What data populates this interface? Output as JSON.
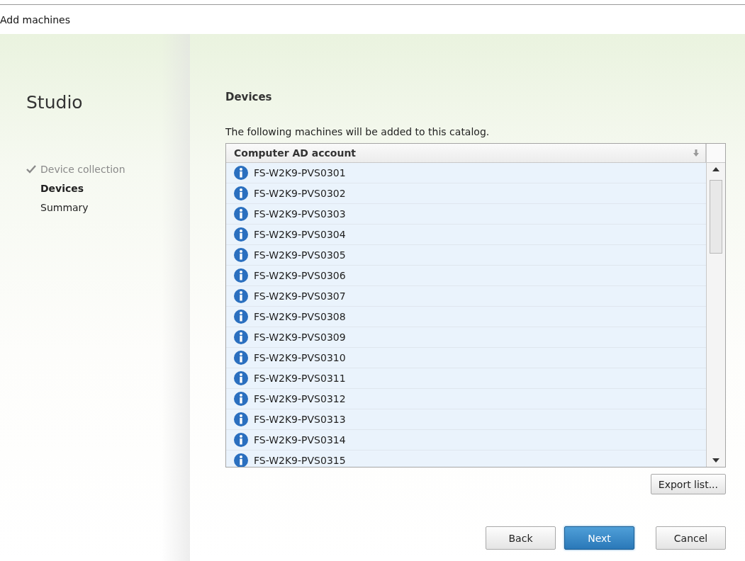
{
  "window": {
    "title": "Add machines"
  },
  "sidebar": {
    "title": "Studio",
    "steps": [
      {
        "label": "Device collection",
        "completed": true,
        "selected": false
      },
      {
        "label": "Devices",
        "completed": false,
        "selected": true
      },
      {
        "label": "Summary",
        "completed": false,
        "selected": false
      }
    ]
  },
  "page": {
    "heading": "Devices",
    "description": "The following machines will be added to this catalog."
  },
  "table": {
    "columns": [
      {
        "label": "Computer AD account",
        "sorted": true
      }
    ],
    "rows": [
      {
        "name": "FS-W2K9-PVS0301"
      },
      {
        "name": "FS-W2K9-PVS0302"
      },
      {
        "name": "FS-W2K9-PVS0303"
      },
      {
        "name": "FS-W2K9-PVS0304"
      },
      {
        "name": "FS-W2K9-PVS0305"
      },
      {
        "name": "FS-W2K9-PVS0306"
      },
      {
        "name": "FS-W2K9-PVS0307"
      },
      {
        "name": "FS-W2K9-PVS0308"
      },
      {
        "name": "FS-W2K9-PVS0309"
      },
      {
        "name": "FS-W2K9-PVS0310"
      },
      {
        "name": "FS-W2K9-PVS0311"
      },
      {
        "name": "FS-W2K9-PVS0312"
      },
      {
        "name": "FS-W2K9-PVS0313"
      },
      {
        "name": "FS-W2K9-PVS0314"
      },
      {
        "name": "FS-W2K9-PVS0315"
      }
    ]
  },
  "export_button": {
    "label": "Export list..."
  },
  "buttons": [
    {
      "label": "Back",
      "kind": "normal"
    },
    {
      "label": "Next",
      "kind": "primary"
    },
    {
      "label": "Cancel",
      "kind": "normal"
    }
  ]
}
